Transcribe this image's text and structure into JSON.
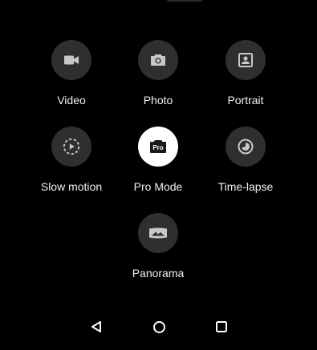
{
  "modes": [
    {
      "label": "Video",
      "icon": "video-camera-icon",
      "active": false
    },
    {
      "label": "Photo",
      "icon": "camera-icon",
      "active": false
    },
    {
      "label": "Portrait",
      "icon": "portrait-icon",
      "active": false
    },
    {
      "label": "Slow motion",
      "icon": "slow-motion-icon",
      "active": false
    },
    {
      "label": "Pro Mode",
      "icon": "pro-mode-icon",
      "icon_text": "Pro",
      "active": true
    },
    {
      "label": "Time-lapse",
      "icon": "time-lapse-icon",
      "active": false
    },
    {
      "label": "Panorama",
      "icon": "panorama-icon",
      "active": false
    }
  ],
  "nav_bar": {
    "buttons": [
      "back-icon",
      "home-icon",
      "recents-icon"
    ]
  },
  "colors": {
    "background": "#000000",
    "tile": "#2f2f2f",
    "icon": "#c8c8c8",
    "active_tile": "#ffffff",
    "label": "#f0f0f0"
  }
}
